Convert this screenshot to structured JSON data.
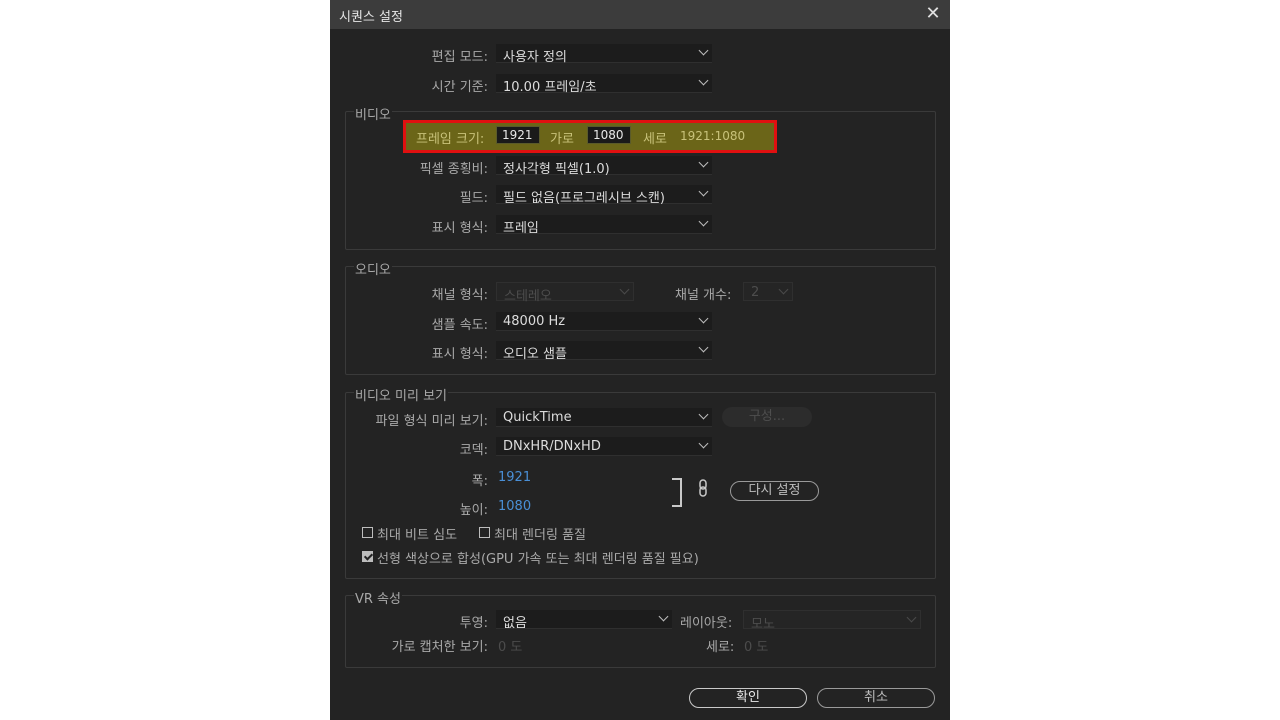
{
  "window": {
    "title": "시퀀스 설정",
    "close_glyph": "✕"
  },
  "general": {
    "edit_mode": {
      "label": "편집 모드:",
      "value": "사용자 정의"
    },
    "timebase": {
      "label": "시간 기준:",
      "value": "10.00  프레임/초"
    }
  },
  "video": {
    "group_title": "비디오",
    "frame_size": {
      "label": "프레임 크기:",
      "width": "1921",
      "width_label": "가로",
      "height": "1080",
      "height_label": "세로",
      "ratio": "1921:1080"
    },
    "pixel_aspect": {
      "label": "픽셀 종횡비:",
      "value": "정사각형 픽셀(1.0)"
    },
    "fields": {
      "label": "필드:",
      "value": "필드 없음(프로그레시브 스캔)"
    },
    "display_format": {
      "label": "표시 형식:",
      "value": "프레임"
    }
  },
  "audio": {
    "group_title": "오디오",
    "channel_format": {
      "label": "채널 형식:",
      "value": "스테레오"
    },
    "channel_count": {
      "label": "채널 개수:",
      "value": "2"
    },
    "sample_rate": {
      "label": "샘플 속도:",
      "value": "48000 Hz"
    },
    "display_format": {
      "label": "표시 형식:",
      "value": "오디오 샘플"
    }
  },
  "preview": {
    "group_title": "비디오 미리 보기",
    "file_format": {
      "label": "파일 형식 미리 보기:",
      "value": "QuickTime"
    },
    "configure_label": "구성...",
    "codec": {
      "label": "코덱:",
      "value": "DNxHR/DNxHD"
    },
    "width": {
      "label": "폭:",
      "value": "1921"
    },
    "height": {
      "label": "높이:",
      "value": "1080"
    },
    "reset_label": "다시 설정",
    "max_bit_depth": {
      "label": "최대 비트 심도",
      "checked": false
    },
    "max_render_quality": {
      "label": "최대 렌더링 품질",
      "checked": false
    },
    "linear_color": {
      "label": "선형 색상으로 합성(GPU 가속 또는 최대 렌더링 품질 필요)",
      "checked": true
    }
  },
  "vr": {
    "group_title": "VR 속성",
    "projection": {
      "label": "투영:",
      "value": "없음"
    },
    "layout": {
      "label": "레이아웃:",
      "value": "모노"
    },
    "h_captured": {
      "label": "가로 캡처한 보기:",
      "value": "0 도"
    },
    "vertical": {
      "label": "세로:",
      "value": "0 도"
    }
  },
  "footer": {
    "ok_label": "확인",
    "cancel_label": "취소"
  },
  "colors": {
    "highlight_fill": "#6b6518",
    "highlight_border": "#e01010",
    "link_blue": "#4a8fd6",
    "dialog_bg": "#232323"
  }
}
